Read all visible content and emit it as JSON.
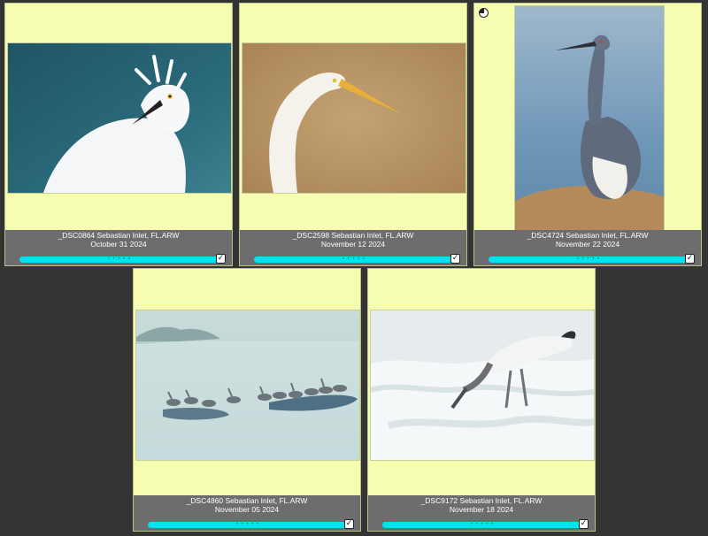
{
  "thumbnails": [
    {
      "filename": "_DSC0864 Sebastian Inlet, FL.ARW",
      "date": "October 31 2024",
      "rating_dots": "• • • • •",
      "selected": true
    },
    {
      "filename": "_DSC2598 Sebastian Inlet, FL.ARW",
      "date": "November 12 2024",
      "rating_dots": "• • • • •",
      "selected": true
    },
    {
      "filename": "_DSC4724 Sebastian Inlet, FL.ARW",
      "date": "November 22 2024",
      "rating_dots": "• • • • •",
      "selected": true
    },
    {
      "filename": "_DSC4860 Sebastian Inlet, FL.ARW",
      "date": "November 05 2024",
      "rating_dots": "• • • • •",
      "selected": true
    },
    {
      "filename": "_DSC9172 Sebastian Inlet, FL.ARW",
      "date": "November 18 2024",
      "rating_dots": "• • • • •",
      "selected": true
    }
  ],
  "check_glyph": "✓",
  "colors": {
    "cell_background": "#f6fdb0",
    "caption_background": "#6d6d6d",
    "label_bar": "#00e3f0",
    "grid_background": "#333333"
  }
}
